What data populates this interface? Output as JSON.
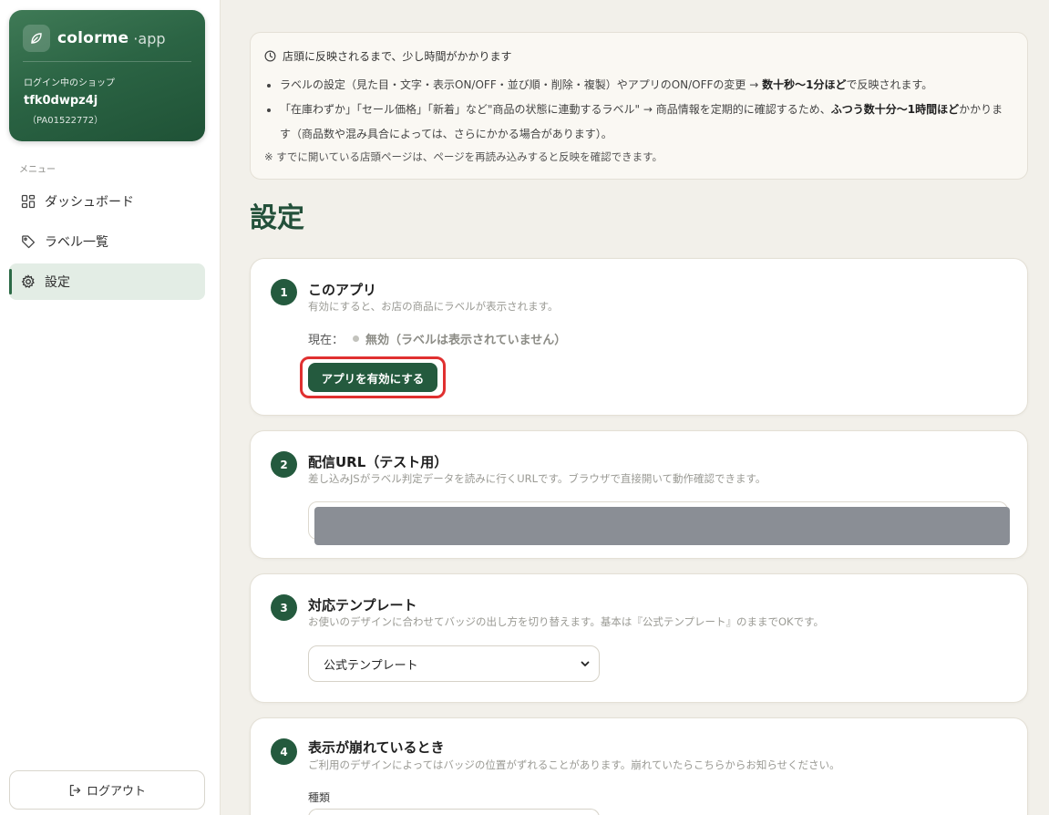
{
  "app": {
    "brand_name": "colorme",
    "brand_suffix": "·app",
    "shop_label": "ログイン中のショップ",
    "shop_id": "tfk0dwpz4j",
    "shop_code": "（PA01522772）"
  },
  "sidebar": {
    "menu_heading": "メニュー",
    "items": [
      {
        "label": "ダッシュボード",
        "icon": "dashboard-icon"
      },
      {
        "label": "ラベル一覧",
        "icon": "tag-icon"
      },
      {
        "label": "設定",
        "icon": "gear-icon",
        "active": true
      }
    ],
    "logout_label": "ログアウト"
  },
  "notice": {
    "title": "店頭に反映されるまで、少し時間がかかります",
    "item1_a": "ラベルの設定（見た目・文字・表示ON/OFF・並び順・削除・複製）やアプリのON/OFFの変更 → ",
    "item1_b": "数十秒〜1分ほど",
    "item1_c": "で反映されます。",
    "item2_a": "「在庫わずか」「セール価格」「新着」など\"商品の状態に連動するラベル\" → 商品情報を定期的に確認するため、",
    "item2_b": "ふつう数十分〜1時間ほど",
    "item2_c": "かかります（商品数や混み具合によっては、さらにかかる場合があります）。",
    "footer": "※ すでに開いている店頭ページは、ページを再読み込みすると反映を確認できます。"
  },
  "page_title": "設定",
  "sections": {
    "app": {
      "step": "1",
      "title": "このアプリ",
      "subtitle": "有効にすると、お店の商品にラベルが表示されます。",
      "status_label": "現在：",
      "status_value": "無効（ラベルは表示されていません）",
      "button": "アプリを有効にする"
    },
    "url": {
      "step": "2",
      "title": "配信URL（テスト用）",
      "subtitle": "差し込みJSがラベル判定データを読みに行くURLです。ブラウザで直接開いて動作確認できます。"
    },
    "template": {
      "step": "3",
      "title": "対応テンプレート",
      "subtitle": "お使いのデザインに合わせてバッジの出し方を切り替えます。基本は『公式テンプレート』のままでOKです。",
      "selected": "公式テンプレート"
    },
    "broken": {
      "step": "4",
      "title": "表示が崩れているとき",
      "subtitle": "ご利用のデザインによってはバッジの位置がずれることがあります。崩れていたらこちらからお知らせください。",
      "kind_label": "種類"
    }
  },
  "colors": {
    "brand_green": "#245a3e",
    "highlight_red": "#e03030",
    "background": "#f2f0ea"
  }
}
